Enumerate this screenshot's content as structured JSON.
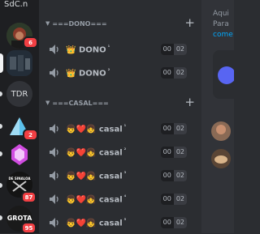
{
  "servers": {
    "top_label": "SdC.n",
    "items": [
      {
        "name": "server-avatar-red-hair",
        "badge": "6"
      },
      {
        "name": "server-avatar-photo",
        "badge": ""
      },
      {
        "name": "server-tdr",
        "label": "TDR",
        "badge": ""
      },
      {
        "name": "server-triangle-crystal",
        "badge": "2"
      },
      {
        "name": "server-purple-crystal",
        "badge": ""
      },
      {
        "name": "server-sinaloa",
        "label": "DE SINALOA",
        "badge": "87"
      },
      {
        "name": "server-grota",
        "label": "GROTA",
        "badge": "95"
      }
    ]
  },
  "channels": {
    "dono_category": "===DONO===",
    "casal_category": "===CASAL===",
    "dono": [
      {
        "emoji": "👑",
        "label": "DONO",
        "sup": "¹",
        "count": "00",
        "limit": "02"
      },
      {
        "emoji": "👑",
        "label": "DONO",
        "sup": "²",
        "count": "00",
        "limit": "02"
      }
    ],
    "casal": [
      {
        "emoji": "👦❤️👧",
        "label": "casal",
        "sup": "¹",
        "count": "00",
        "limit": "02"
      },
      {
        "emoji": "👦❤️👧",
        "label": "casal",
        "sup": "²",
        "count": "00",
        "limit": "02"
      },
      {
        "emoji": "👦❤️👧",
        "label": "casal",
        "sup": "³",
        "count": "00",
        "limit": "02"
      },
      {
        "emoji": "👦❤️👧",
        "label": "casal",
        "sup": "⁴",
        "count": "00",
        "limit": "02"
      },
      {
        "emoji": "👦❤️👧",
        "label": "casal",
        "sup": "⁵",
        "count": "00",
        "limit": "02"
      }
    ]
  },
  "chat": {
    "line1": "Aqui",
    "line2": "Para",
    "line3": "come"
  },
  "colors": {
    "accent": "#5865f2",
    "badge": "#f23f43",
    "link": "#00a8fc"
  }
}
